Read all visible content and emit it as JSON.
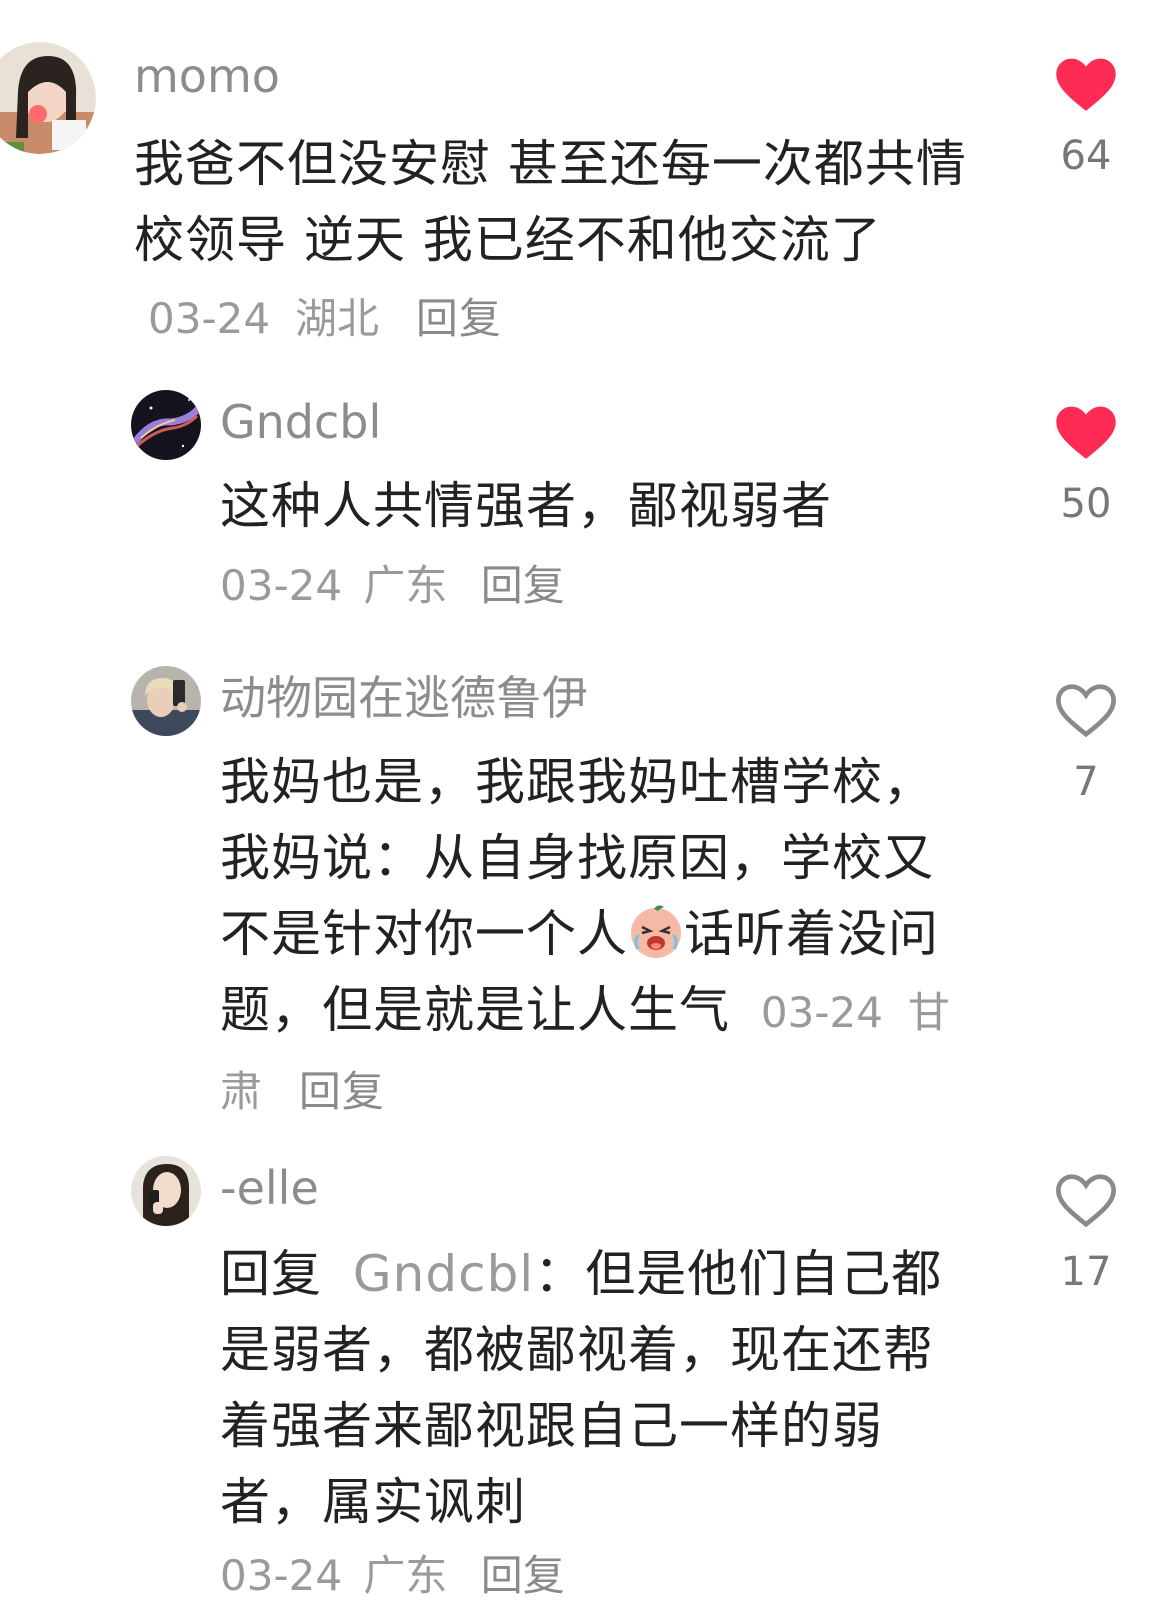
{
  "comments": [
    {
      "username": "momo",
      "text": "我爸不但没安慰 甚至还每一次都共情校领导 逆天 我已经不和他交流了",
      "date": "03-24",
      "location": "湖北",
      "reply_label": "回复",
      "likes": "64",
      "liked": true
    },
    {
      "username": "Gndcbl",
      "text": "这种人共情强者，鄙视弱者",
      "date": "03-24",
      "location": "广东",
      "reply_label": "回复",
      "likes": "50",
      "liked": true
    },
    {
      "username": "动物园在逃德鲁伊",
      "text_part1": "我妈也是，我跟我妈吐槽学校，我妈说：从自身找原因，学校又不是针对你一个人",
      "text_part2": "话听着没问题，但是就是让人生气",
      "emoji_icon": "crying-face-emoji-icon",
      "date": "03-24",
      "location": "甘肃",
      "reply_label": "回复",
      "likes": "7",
      "liked": false
    },
    {
      "username": "-elle",
      "reply_prefix": "回复",
      "mention": "Gndcbl",
      "text": "：但是他们自己都是弱者，都被鄙视着，现在还帮着强者来鄙视跟自己一样的弱者，属实讽刺",
      "date": "03-24",
      "location": "广东",
      "reply_label": "回复",
      "likes": "17",
      "liked": false
    }
  ],
  "colors": {
    "liked_heart": "#fe2c55",
    "unliked_heart": "#8a8a8a",
    "username": "#8c8c8c",
    "body_text": "#222222",
    "meta_text": "#9a9a9a"
  }
}
